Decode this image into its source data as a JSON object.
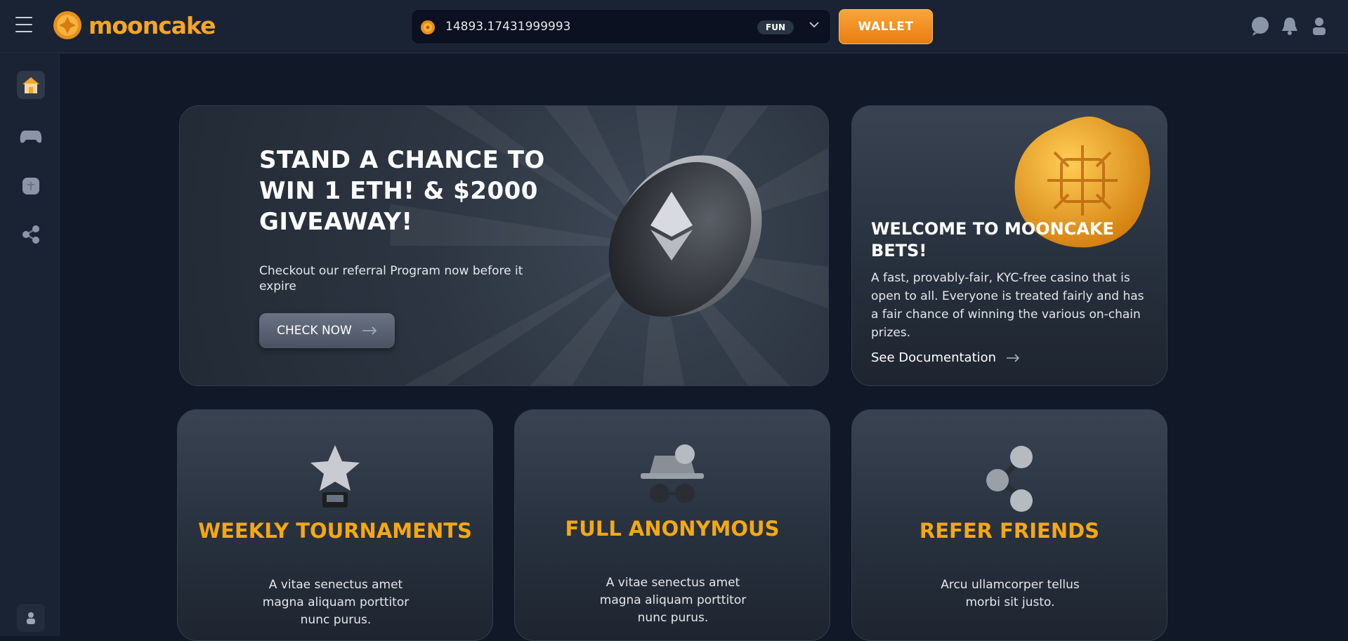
{
  "header": {
    "logo_text": "mooncake",
    "balance": "14893.17431999993",
    "currency_badge": "FUN",
    "wallet_label": "WALLET",
    "icons": [
      "chat-icon",
      "bell-icon",
      "user-icon"
    ]
  },
  "sidebar": {
    "items": [
      {
        "name": "home",
        "icon": "home-icon",
        "active": true
      },
      {
        "name": "games",
        "icon": "gamepad-icon",
        "active": false
      },
      {
        "name": "mooncake",
        "icon": "mooncake-icon",
        "active": false
      },
      {
        "name": "referral",
        "icon": "share-icon",
        "active": false
      }
    ],
    "bottom_icon": "user-icon"
  },
  "hero": {
    "title": "STAND A CHANCE TO WIN 1 ETH! & $2000 GIVEAWAY!",
    "subtitle": "Checkout our referral Program now before it expire",
    "button_label": "CHECK NOW"
  },
  "welcome": {
    "title": "WELCOME TO MOONCAKE BETS!",
    "text": "A fast, provably-fair, KYC-free casino that is open to all. Everyone is treated fairly and has a fair chance of winning the various on-chain prizes.",
    "link_label": "See Documentation"
  },
  "features": [
    {
      "title": "WEEKLY TOURNAMENTS",
      "text": "A vitae senectus amet magna aliquam porttitor nunc purus.",
      "icon": "trophy-icon"
    },
    {
      "title": "FULL ANONYMOUS",
      "text": "A vitae senectus amet magna aliquam porttitor nunc purus.",
      "icon": "incognito-icon"
    },
    {
      "title": "REFER FRIENDS",
      "text": "Arcu ullamcorper tellus morbi sit justo.",
      "icon": "share-icon"
    }
  ],
  "colors": {
    "accent": "#f6a623",
    "title_accent": "#f5a812",
    "bg": "#111827",
    "panel": "#1a2333"
  }
}
